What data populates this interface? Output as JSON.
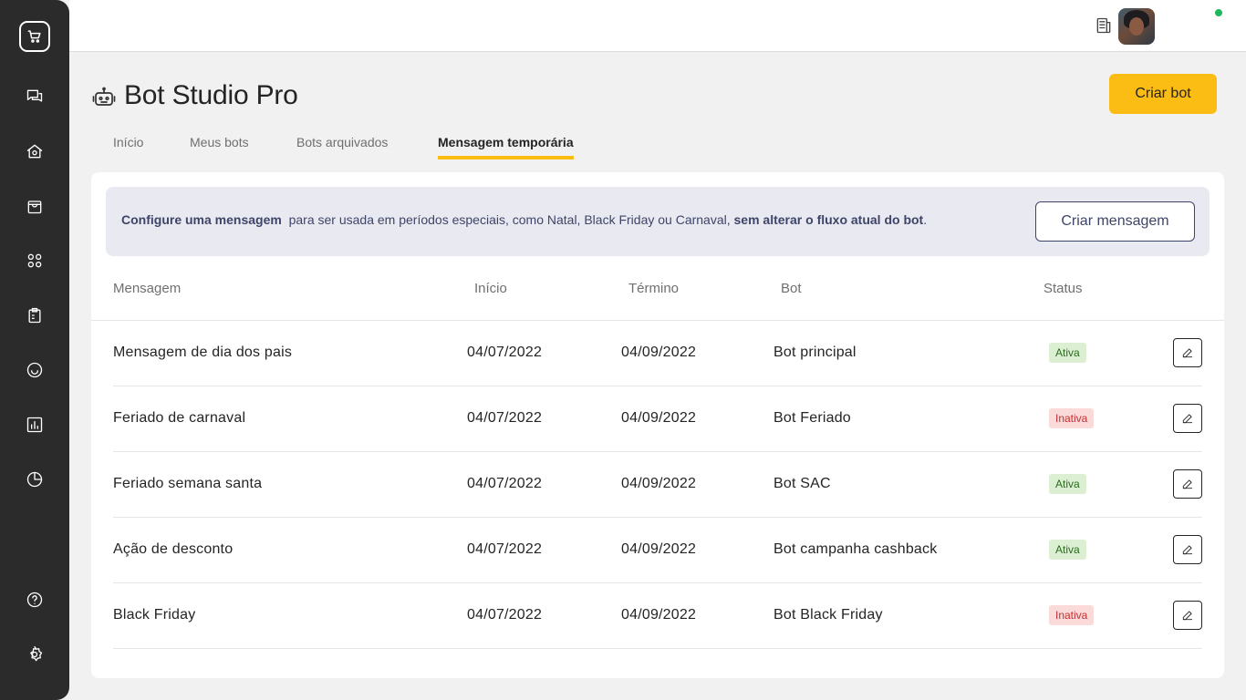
{
  "sidebar": {
    "logo_icon": "shopping-cart-chat-icon",
    "items": [
      {
        "name": "chat",
        "icon": "chat-icon"
      },
      {
        "name": "home",
        "icon": "store-icon"
      },
      {
        "name": "shopping-bag",
        "icon": "shopping-bag-icon"
      },
      {
        "name": "apps",
        "icon": "apps-grid-icon"
      },
      {
        "name": "clipboard",
        "icon": "clipboard-icon"
      },
      {
        "name": "smile",
        "icon": "smile-icon"
      },
      {
        "name": "reports",
        "icon": "bar-chart-icon"
      },
      {
        "name": "analytics",
        "icon": "pie-chart-icon"
      }
    ],
    "bottom_items": [
      {
        "name": "help",
        "icon": "help-icon"
      },
      {
        "name": "settings",
        "icon": "gear-icon"
      }
    ]
  },
  "topbar": {
    "icons": [
      "news-icon",
      "lightbulb-icon"
    ],
    "status_color": "#1fb85c"
  },
  "header": {
    "title": "Bot Studio Pro",
    "title_icon": "bot-icon",
    "create_bot_label": "Criar bot",
    "accent_color": "#fbbd14"
  },
  "tabs": [
    {
      "label": "Início",
      "active": false
    },
    {
      "label": "Meus bots",
      "active": false
    },
    {
      "label": "Bots arquivados",
      "active": false
    },
    {
      "label": "Mensagem temporária",
      "active": true
    }
  ],
  "banner": {
    "bold_start": "Configure uma mensagem",
    "middle": "para ser usada em períodos especiais, como Natal, Black Friday ou Carnaval,",
    "bold_end": "sem alterar o fluxo atual do bot",
    "end": ".",
    "button_label": "Criar mensagem"
  },
  "table": {
    "columns": [
      "Mensagem",
      "Início",
      "Término",
      "Bot",
      "Status"
    ],
    "rows": [
      {
        "mensagem": "Mensagem de dia dos pais",
        "inicio": "04/07/2022",
        "termino": "04/09/2022",
        "bot": "Bot principal",
        "status": "Ativa"
      },
      {
        "mensagem": "Feriado de carnaval",
        "inicio": "04/07/2022",
        "termino": "04/09/2022",
        "bot": "Bot Feriado",
        "status": "Inativa"
      },
      {
        "mensagem": "Feriado semana santa",
        "inicio": "04/07/2022",
        "termino": "04/09/2022",
        "bot": "Bot SAC",
        "status": "Ativa"
      },
      {
        "mensagem": "Ação de desconto",
        "inicio": "04/07/2022",
        "termino": "04/09/2022",
        "bot": "Bot campanha cashback",
        "status": "Ativa"
      },
      {
        "mensagem": "Black Friday",
        "inicio": "04/07/2022",
        "termino": "04/09/2022",
        "bot": "Bot Black Friday",
        "status": "Inativa"
      }
    ]
  },
  "status_colors": {
    "Ativa": "#2b6a1d",
    "Inativa": "#c23030"
  }
}
